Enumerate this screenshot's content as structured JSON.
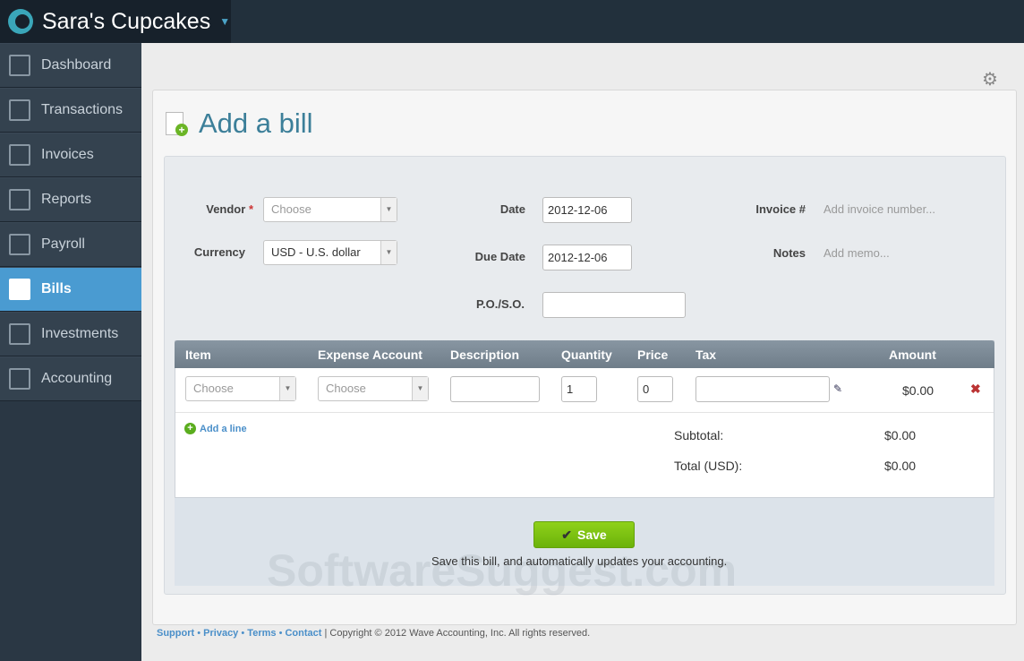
{
  "brand": {
    "name": "Sara's Cupcakes"
  },
  "sidebar": {
    "items": [
      {
        "label": "Dashboard"
      },
      {
        "label": "Transactions"
      },
      {
        "label": "Invoices"
      },
      {
        "label": "Reports"
      },
      {
        "label": "Payroll"
      },
      {
        "label": "Bills"
      },
      {
        "label": "Investments"
      },
      {
        "label": "Accounting"
      }
    ]
  },
  "page": {
    "title": "Add a bill"
  },
  "form": {
    "vendor_label": "Vendor",
    "required_mark": "*",
    "vendor_value": "Choose",
    "currency_label": "Currency",
    "currency_value": "USD - U.S. dollar",
    "date_label": "Date",
    "date_value": "2012-12-06",
    "due_label": "Due Date",
    "due_value": "2012-12-06",
    "po_label": "P.O./S.O.",
    "invoice_label": "Invoice #",
    "invoice_placeholder": "Add invoice number...",
    "notes_label": "Notes",
    "notes_placeholder": "Add memo..."
  },
  "table": {
    "headers": [
      "Item",
      "Expense Account",
      "Description",
      "Quantity",
      "Price",
      "Tax",
      "Amount"
    ],
    "row": {
      "item": "Choose",
      "account": "Choose",
      "quantity": "1",
      "price": "0",
      "amount": "$0.00"
    },
    "add_line": "Add a line",
    "subtotal_label": "Subtotal:",
    "subtotal": "$0.00",
    "total_label": "Total (USD):",
    "total": "$0.00"
  },
  "save": {
    "label": "Save",
    "note": "Save this bill, and automatically updates your accounting."
  },
  "watermark": "SoftwareSuggest.com",
  "footer": {
    "links": [
      "Support",
      "Privacy",
      "Terms",
      "Contact"
    ],
    "copyright": "| Copyright © 2012 Wave Accounting, Inc. All rights reserved."
  }
}
